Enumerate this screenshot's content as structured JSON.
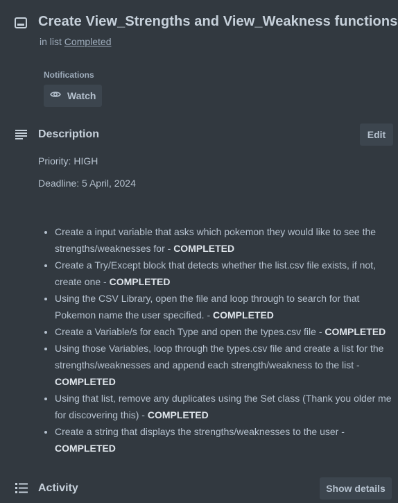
{
  "card": {
    "title": "Create View_Strengths and View_Weakness functions",
    "in_list_prefix": "in list",
    "list_name": "Completed"
  },
  "notifications": {
    "label": "Notifications",
    "watch_label": "Watch"
  },
  "description": {
    "title": "Description",
    "edit_label": "Edit",
    "priority": "Priority: HIGH",
    "deadline": "Deadline: 5 April, 2024",
    "tasks": [
      {
        "text": "Create a input variable that asks which pokemon they would like to see the strengths/weaknesses for - ",
        "status": "COMPLETED"
      },
      {
        "text": "Create a Try/Except block that detects whether the list.csv file exists, if not, create one - ",
        "status": "COMPLETED"
      },
      {
        "text": "Using the CSV Library, open the file and loop through to search for that Pokemon name the user specified. - ",
        "status": "COMPLETED"
      },
      {
        "text": "Create a Variable/s for each Type and open the types.csv file - ",
        "status": "COMPLETED"
      },
      {
        "text": "Using those Variables, loop through the types.csv file and create a list for the strengths/weaknesses and append each strength/weakness to the list - ",
        "status": "COMPLETED"
      },
      {
        "text": "Using that list, remove any duplicates using the Set class (Thank you older me for discovering this) - ",
        "status": "COMPLETED"
      },
      {
        "text": "Create a string that displays the strengths/weaknesses to the user - ",
        "status": "COMPLETED"
      }
    ]
  },
  "activity": {
    "title": "Activity",
    "show_details_label": "Show details"
  },
  "icons": {
    "card": "card-icon",
    "eye": "eye-icon",
    "description": "description-lines-icon",
    "activity": "activity-list-icon"
  }
}
